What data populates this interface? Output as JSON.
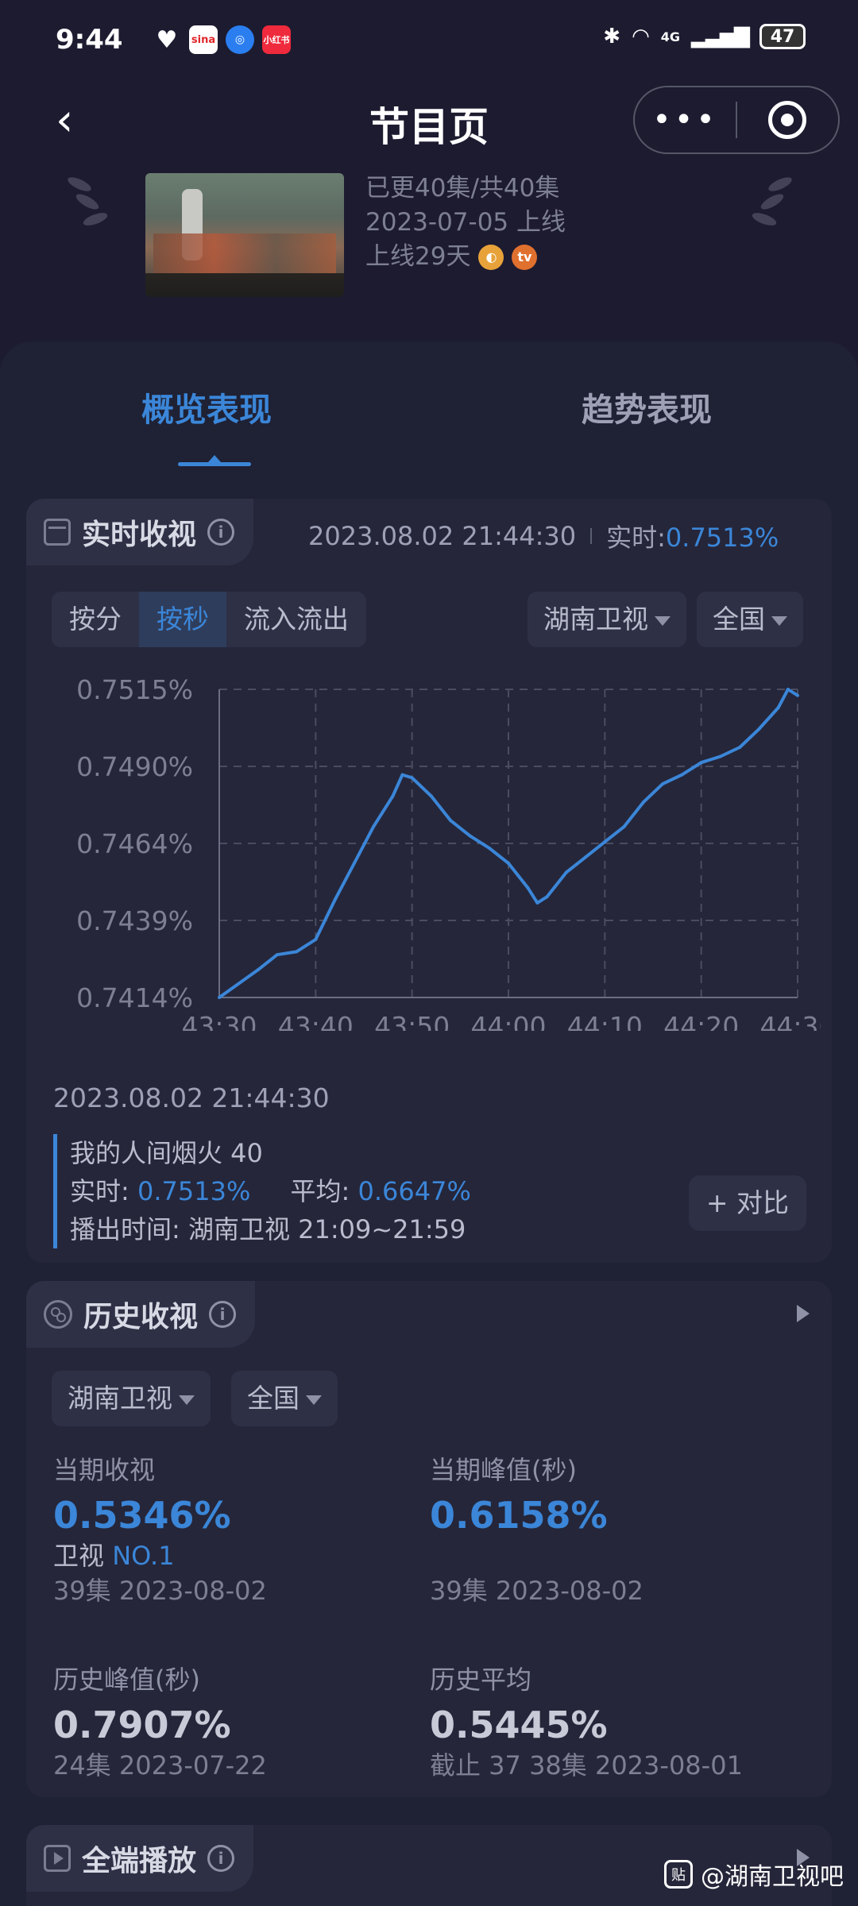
{
  "status_bar": {
    "time": "9:44",
    "app_icons": [
      "heart-icon",
      "sina-icon",
      "browser-icon",
      "xiaohongshu-icon"
    ],
    "network": "4G",
    "battery": "47"
  },
  "nav": {
    "title": "节目页",
    "more": "•••"
  },
  "show": {
    "episodes": "已更40集/共40集",
    "launch": "2023-07-05 上线",
    "days": "上线29天",
    "platforms": [
      "mango-tv-icon",
      "tv-logo-icon"
    ]
  },
  "tabs": [
    {
      "label": "概览表现",
      "active": true
    },
    {
      "label": "趋势表现",
      "active": false
    }
  ],
  "realtime": {
    "title": "实时收视",
    "timestamp": "2023.08.02 21:44:30",
    "rt_label": "实时:",
    "rt_value": "0.7513%",
    "seg": [
      "按分",
      "按秒",
      "流入流出"
    ],
    "channel": "湖南卫视",
    "region": "全国",
    "legend": {
      "date": "2023.08.02 21:44:30",
      "show": "我的人间烟火 40",
      "rt_label": "实时:",
      "rt_value": "0.7513%",
      "avg_label": "平均:",
      "avg_value": "0.6647%",
      "air": "播出时间:  湖南卫视 21:09~21:59"
    },
    "compare": "+ 对比"
  },
  "chart_data": {
    "type": "line",
    "x": [
      "43:30",
      "43:34",
      "43:36",
      "43:38",
      "43:40",
      "43:42",
      "43:44",
      "43:46",
      "43:48",
      "43:49",
      "43:50",
      "43:52",
      "43:54",
      "43:56",
      "43:58",
      "44:00",
      "44:02",
      "44:03",
      "44:04",
      "44:06",
      "44:08",
      "44:10",
      "44:12",
      "44:14",
      "44:16",
      "44:18",
      "44:20",
      "44:22",
      "44:24",
      "44:26",
      "44:28",
      "44:29",
      "44:30"
    ],
    "values": [
      0.7414,
      0.7423,
      0.7428,
      0.7429,
      0.7433,
      0.7446,
      0.7458,
      0.747,
      0.748,
      0.7487,
      0.7486,
      0.748,
      0.7472,
      0.7467,
      0.7463,
      0.7458,
      0.745,
      0.7445,
      0.7447,
      0.7455,
      0.746,
      0.7465,
      0.747,
      0.7478,
      0.7484,
      0.7487,
      0.7491,
      0.7493,
      0.7496,
      0.7502,
      0.7509,
      0.7515,
      0.7513
    ],
    "ylim": [
      0.7414,
      0.7515
    ],
    "yticks": [
      "0.7515%",
      "0.7490%",
      "0.7464%",
      "0.7439%",
      "0.7414%"
    ],
    "xticks": [
      "43:30",
      "43:40",
      "43:50",
      "44:00",
      "44:10",
      "44:20",
      "44:30"
    ],
    "grid": true,
    "color": "#3b86d8"
  },
  "history": {
    "title": "历史收视",
    "channel": "湖南卫视",
    "region": "全国",
    "cur_label": "当期收视",
    "cur_value": "0.5346%",
    "cur_rank_prefix": "卫视",
    "cur_rank": "NO.1",
    "cur_date": "39集 2023-08-02",
    "peak_label": "当期峰值(秒)",
    "peak_value": "0.6158%",
    "peak_date": "39集 2023-08-02",
    "hpeak_label": "历史峰值(秒)",
    "hpeak_value": "0.7907%",
    "hpeak_date": "24集 2023-07-22",
    "havg_label": "历史平均",
    "havg_value": "0.5445%",
    "havg_date": "截止 37 38集 2023-08-01"
  },
  "allplay": {
    "title": "全端播放"
  },
  "watermark": "@湖南卫视吧"
}
